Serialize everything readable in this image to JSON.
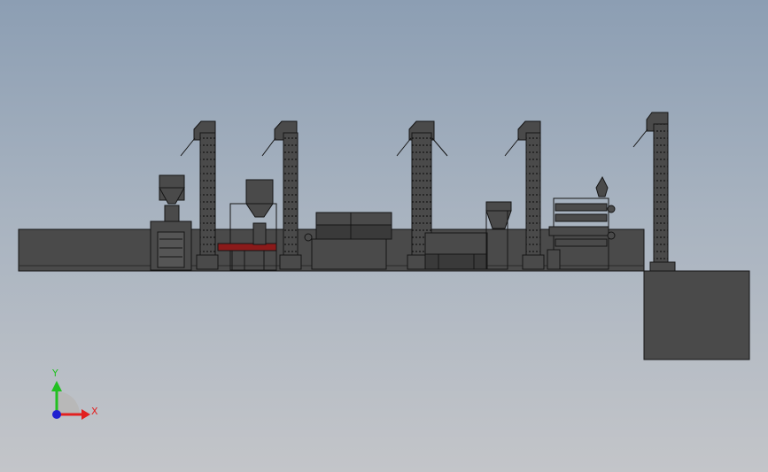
{
  "viewport": {
    "background_top": "#8c9eb3",
    "background_bottom": "#c3c5c9"
  },
  "model": {
    "part_color": "#4a4a4a",
    "edge_color": "#151515",
    "conveyor_color": "#8b1a1a",
    "components": [
      "left-hopper-machine",
      "elevator-1",
      "conveyor-station",
      "elevator-2",
      "screen-cleaner",
      "elevator-3",
      "grader",
      "elevator-4",
      "feed-hopper",
      "multi-deck-sorter",
      "elevator-5",
      "pit-block"
    ]
  },
  "triad": {
    "x_label": "X",
    "y_label": "Y",
    "x_color": "#e22020",
    "y_color": "#22c022",
    "z_color": "#2020d0"
  }
}
